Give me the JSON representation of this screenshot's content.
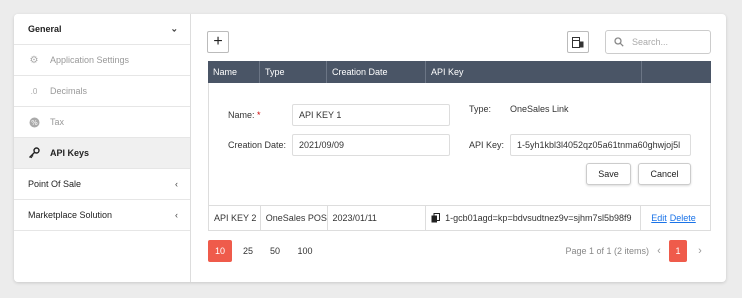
{
  "sidebar": {
    "general": "General",
    "items": [
      {
        "label": "Application Settings",
        "icon": "gear-icon"
      },
      {
        "label": "Decimals",
        "icon": "decimals-icon"
      },
      {
        "label": "Tax",
        "icon": "percent-icon"
      },
      {
        "label": "API Keys",
        "icon": "key-icon"
      }
    ],
    "point_of_sale": "Point Of Sale",
    "marketplace": "Marketplace Solution"
  },
  "toolbar": {
    "add_label": "+",
    "search_placeholder": "Search..."
  },
  "grid": {
    "columns": [
      "Name",
      "Type",
      "Creation Date",
      "API Key"
    ],
    "rows": [
      {
        "name": "API KEY 2",
        "type": "OneSales POS",
        "date": "2023/01/11",
        "key": "1-gcb01agd=kp=bdvsudtnez9v=sjhm7sl5b98f9",
        "edit": "Edit",
        "delete": "Delete"
      }
    ]
  },
  "form": {
    "name_label": "Name:",
    "required_mark": "*",
    "name_value": "API KEY 1",
    "type_label": "Type:",
    "type_value": "OneSales Link",
    "date_label": "Creation Date:",
    "date_value": "2021/09/09",
    "key_label": "API Key:",
    "key_value": "1-5yh1kbl3l4052qz05a61tnma60ghwjoj5l",
    "save_label": "Save",
    "cancel_label": "Cancel"
  },
  "pager": {
    "sizes": [
      "10",
      "25",
      "50",
      "100"
    ],
    "selected_size": "10",
    "info": "Page 1 of 1 (2 items)",
    "current_page": "1"
  },
  "colors": {
    "header_bg": "#4a5566",
    "accent": "#ef5b4b",
    "link": "#1a73e8"
  }
}
